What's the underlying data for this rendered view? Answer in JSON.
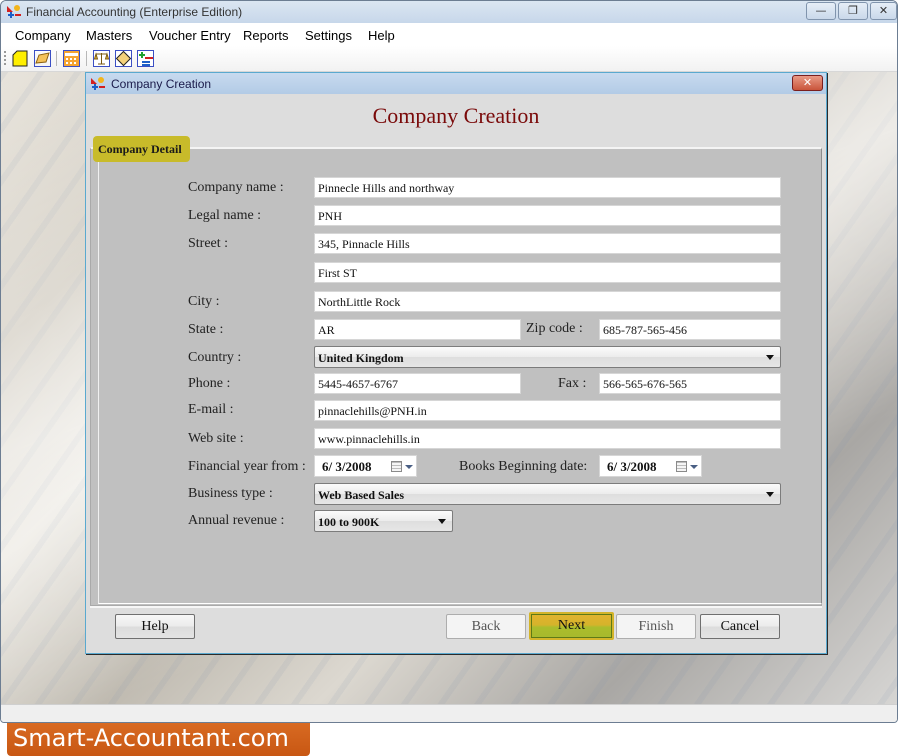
{
  "app": {
    "title": "Financial Accounting (Enterprise Edition)",
    "window_buttons": {
      "minimize": "—",
      "restore": "❐",
      "close": "✕"
    }
  },
  "menu": [
    {
      "label": "Company"
    },
    {
      "label": "Masters"
    },
    {
      "label": "Voucher Entry"
    },
    {
      "label": "Reports"
    },
    {
      "label": "Settings"
    },
    {
      "label": "Help"
    }
  ],
  "toolbar": {
    "icons": [
      "new-company-icon",
      "open-company-icon",
      "calculator-icon",
      "balance-scale-icon",
      "voucher-icon",
      "add-remove-icon"
    ]
  },
  "dialog": {
    "title": "Company Creation",
    "close_label": "✕",
    "heading": "Company Creation",
    "tab": "Company Detail",
    "labels": {
      "company_name": "Company name :",
      "legal_name": "Legal name :",
      "street": "Street :",
      "city": "City :",
      "state": "State :",
      "zip": "Zip code :",
      "country": "Country :",
      "phone": "Phone :",
      "fax": "Fax :",
      "email": "E-mail :",
      "website": "Web site :",
      "fin_year": "Financial year from :",
      "books_begin": "Books Beginning date:",
      "business_type": "Business type :",
      "annual_revenue": "Annual revenue :"
    },
    "values": {
      "company_name": "Pinnecle Hills and northway",
      "legal_name": "PNH",
      "street1": "345, Pinnacle Hills",
      "street2": "First ST",
      "city": "NorthLittle Rock",
      "state": "AR",
      "zip": "685-787-565-456",
      "country": "United Kingdom",
      "phone": "5445-4657-6767",
      "fax": "566-565-676-565",
      "email": "pinnaclehills@PNH.in",
      "website": "www.pinnaclehills.in",
      "fin_year": "6/  3/2008",
      "books_begin": "6/  3/2008",
      "business_type": "Web Based Sales",
      "annual_revenue": "100 to 900K"
    },
    "buttons": {
      "help": "Help",
      "back": "Back",
      "next": "Next",
      "finish": "Finish",
      "cancel": "Cancel"
    }
  },
  "brand": "Smart-Accountant.com"
}
